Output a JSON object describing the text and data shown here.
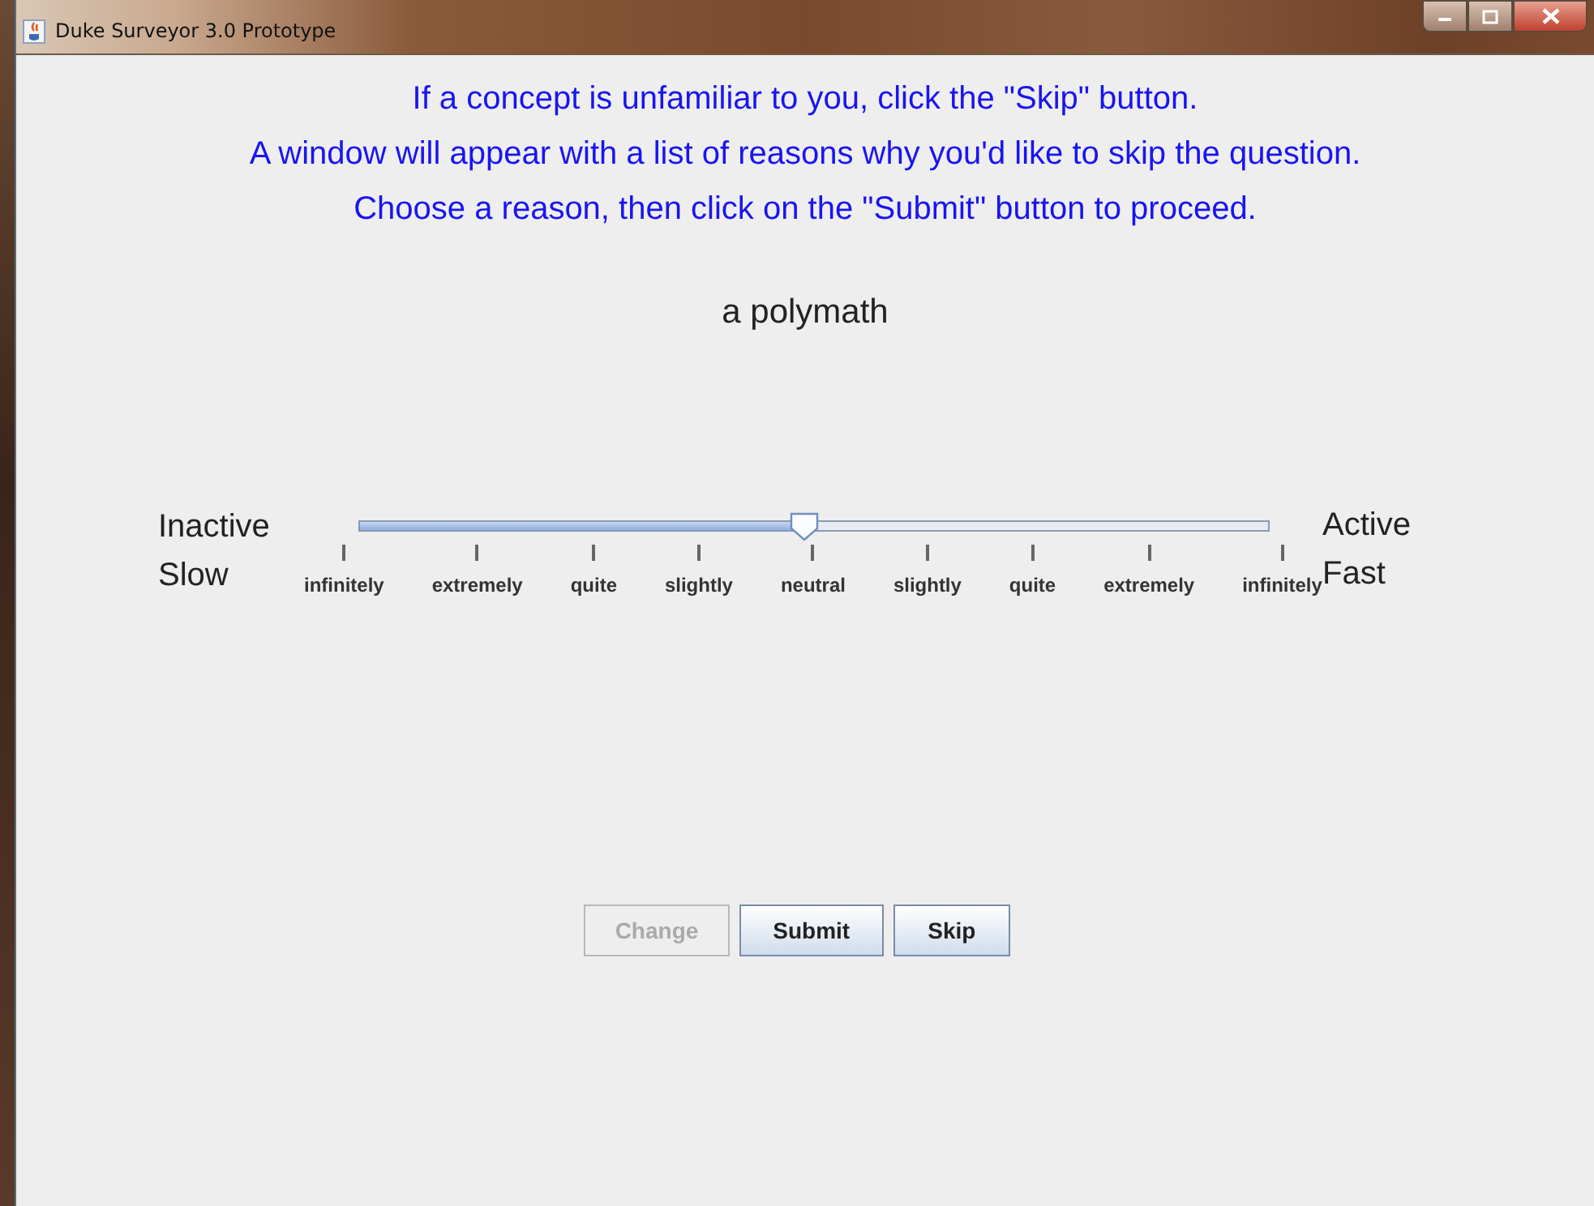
{
  "window": {
    "title": "Duke Surveyor 3.0 Prototype"
  },
  "instructions": [
    "If a concept is unfamiliar to you, click the \"Skip\" button.",
    "A window will appear with a list of reasons why you'd like to skip the question.",
    "Choose a reason, then click on the \"Submit\" button to proceed."
  ],
  "concept": "a polymath",
  "scale": {
    "left_labels": [
      "Inactive",
      "Slow"
    ],
    "right_labels": [
      "Active",
      "Fast"
    ],
    "level": 0.49,
    "tick_labels": [
      "infinitely",
      "extremely",
      "quite",
      "slightly",
      "neutral",
      "slightly",
      "quite",
      "extremely",
      "infinitely"
    ]
  },
  "buttons": [
    {
      "label": "Change",
      "disabled": true
    },
    {
      "label": "Submit",
      "disabled": false
    },
    {
      "label": "Skip",
      "disabled": false
    }
  ]
}
